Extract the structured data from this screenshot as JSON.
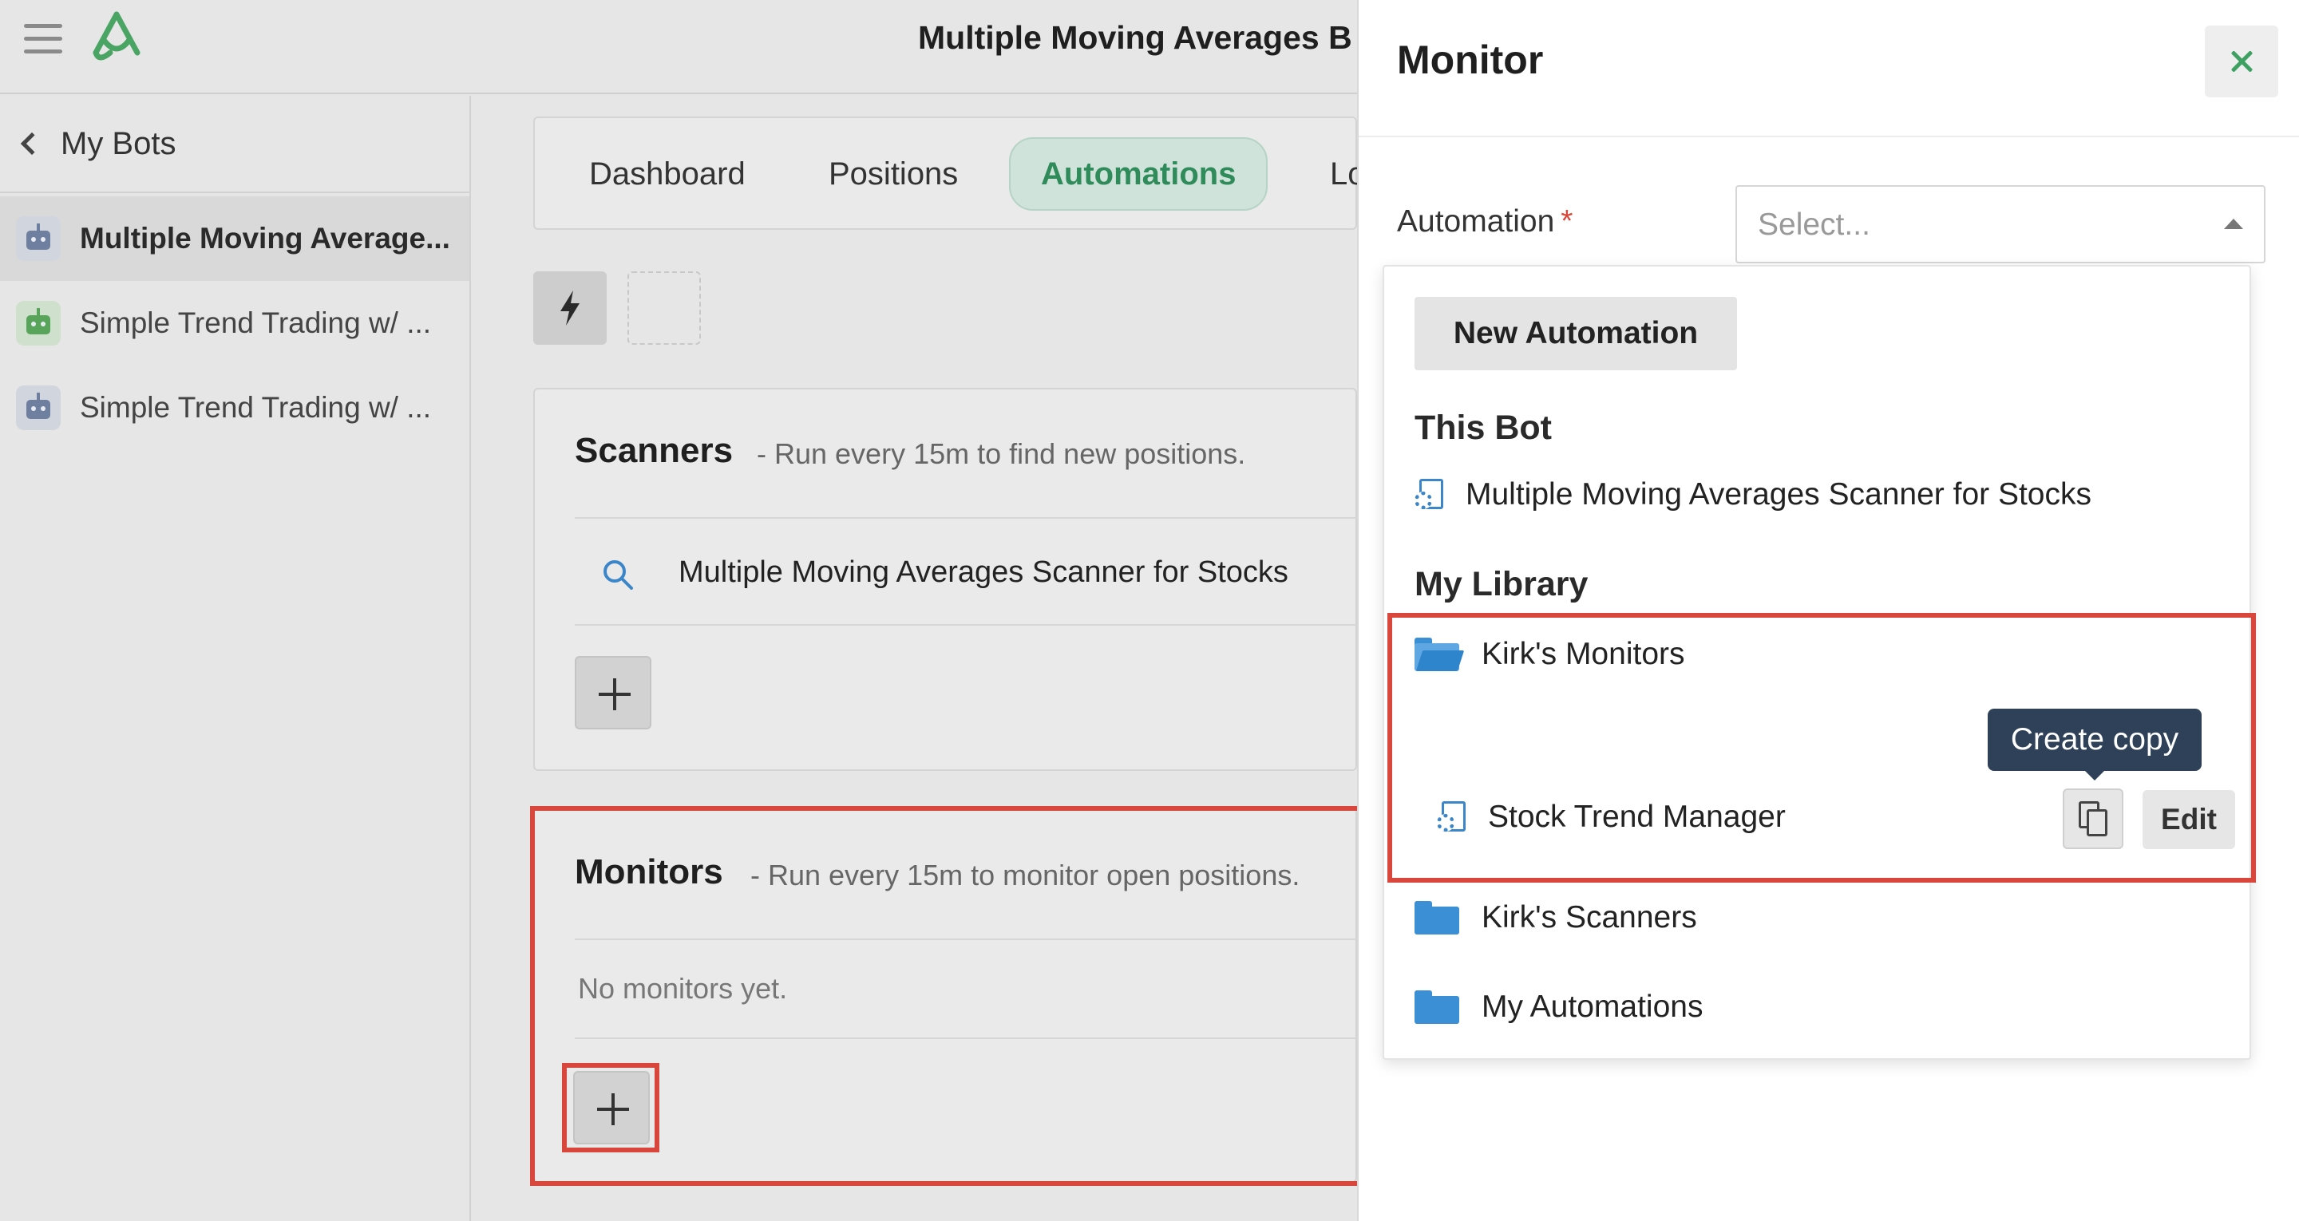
{
  "header": {
    "app_title": "Multiple Moving Averages B"
  },
  "sidebar": {
    "back_label": "My Bots",
    "items": [
      {
        "label": "Multiple Moving Average...",
        "active": true
      },
      {
        "label": "Simple Trend Trading w/ ...",
        "active": false
      },
      {
        "label": "Simple Trend Trading w/ ...",
        "active": false
      }
    ]
  },
  "main": {
    "tabs": [
      {
        "label": "Dashboard"
      },
      {
        "label": "Positions"
      },
      {
        "label": "Automations"
      },
      {
        "label": "Lo"
      }
    ],
    "scanners": {
      "title": "Scanners",
      "subtitle": "- Run every 15m to find new positions.",
      "item": "Multiple Moving Averages Scanner for Stocks"
    },
    "monitors": {
      "title": "Monitors",
      "subtitle": "- Run every 15m to monitor open positions.",
      "empty": "No monitors yet."
    }
  },
  "panel": {
    "title": "Monitor",
    "field_label": "Automation",
    "required_mark": "*",
    "select_placeholder": "Select...",
    "dropdown": {
      "new_button": "New Automation",
      "this_bot_title": "This Bot",
      "this_bot_item": "Multiple Moving Averages Scanner for Stocks",
      "library_title": "My Library",
      "folders": [
        {
          "label": "Kirk's Monitors",
          "open": true
        },
        {
          "label": "Kirk's Scanners",
          "open": false
        },
        {
          "label": "My Automations",
          "open": false
        }
      ],
      "library_item": "Stock Trend Manager",
      "tooltip": "Create copy",
      "edit_label": "Edit"
    }
  },
  "colors": {
    "accent_green": "#2f8c5a",
    "highlight_red": "#d9473c",
    "folder_blue": "#3b8fd4",
    "tooltip_bg": "#2e4158"
  }
}
